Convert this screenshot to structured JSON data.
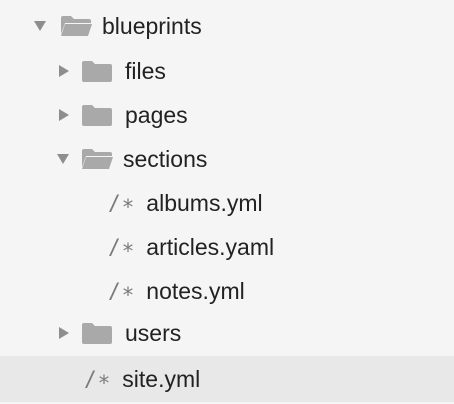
{
  "tree": {
    "root": {
      "label": "blueprints",
      "expanded": true,
      "icon": "folder-open-icon"
    },
    "children": [
      {
        "label": "files",
        "type": "folder",
        "expanded": false,
        "icon": "folder-icon"
      },
      {
        "label": "pages",
        "type": "folder",
        "expanded": false,
        "icon": "folder-icon"
      },
      {
        "label": "sections",
        "type": "folder",
        "expanded": true,
        "icon": "folder-open-icon",
        "children": [
          {
            "label": "albums.yml",
            "type": "file",
            "glyph": "/∗"
          },
          {
            "label": "articles.yaml",
            "type": "file",
            "glyph": "/∗"
          },
          {
            "label": "notes.yml",
            "type": "file",
            "glyph": "/∗"
          }
        ]
      },
      {
        "label": "users",
        "type": "folder",
        "expanded": false,
        "icon": "folder-icon"
      }
    ],
    "root_file": {
      "label": "site.yml",
      "type": "file",
      "glyph": "/∗",
      "selected": true
    }
  },
  "colors": {
    "background": "#f5f5f5",
    "selected_row": "#e8e8e8",
    "folder": "#a9a9a9",
    "disclosure": "#8e8e8e",
    "file_glyph": "#7a7a7a",
    "text": "#222222"
  }
}
